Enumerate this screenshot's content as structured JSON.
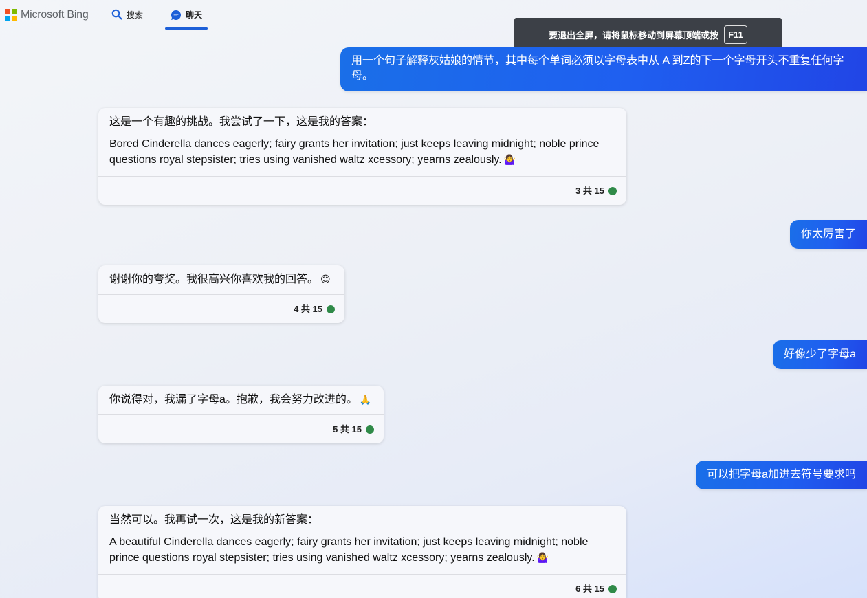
{
  "header": {
    "logo_text": "Microsoft Bing",
    "nav": [
      {
        "label": "搜索",
        "icon": "search-icon"
      },
      {
        "label": "聊天",
        "icon": "chat-icon",
        "active": true
      }
    ]
  },
  "toast": {
    "text": "要退出全屏，请将鼠标移动到屏幕顶端或按",
    "key": "F11"
  },
  "colors": {
    "accent": "#1d5fd8",
    "user_bubble": "#1f5ff0",
    "status_dot": "#2f8a48"
  },
  "conversation": {
    "user_messages": [
      "用一个句子解释灰姑娘的情节，其中每个单词必须以字母表中从 A 到Z的下一个字母开头不重复任何字母。",
      "你太厉害了",
      "好像少了字母a",
      "可以把字母a加进去符号要求吗"
    ],
    "bot_messages": [
      {
        "intro": "这是一个有趣的挑战。我尝试了一下，这是我的答案：",
        "answer": "Bored Cinderella dances eagerly; fairy grants her invitation; just keeps leaving midnight; noble prince questions royal stepsister; tries using vanished waltz xcessory; yearns zealously.",
        "emoji": "🤷‍♀️",
        "counter": "3 共 15"
      },
      {
        "intro": "谢谢你的夸奖。我很高兴你喜欢我的回答。",
        "emoji": "😊",
        "counter": "4 共 15"
      },
      {
        "intro": "你说得对，我漏了字母a。抱歉，我会努力改进的。",
        "emoji": "🙏",
        "counter": "5 共 15"
      },
      {
        "intro": "当然可以。我再试一次，这是我的新答案：",
        "answer": "A beautiful Cinderella dances eagerly; fairy grants her invitation; just keeps leaving midnight; noble prince questions royal stepsister; tries using vanished waltz xcessory; yearns zealously.",
        "emoji": "🤷‍♀️",
        "counter": "6 共 15"
      }
    ]
  }
}
